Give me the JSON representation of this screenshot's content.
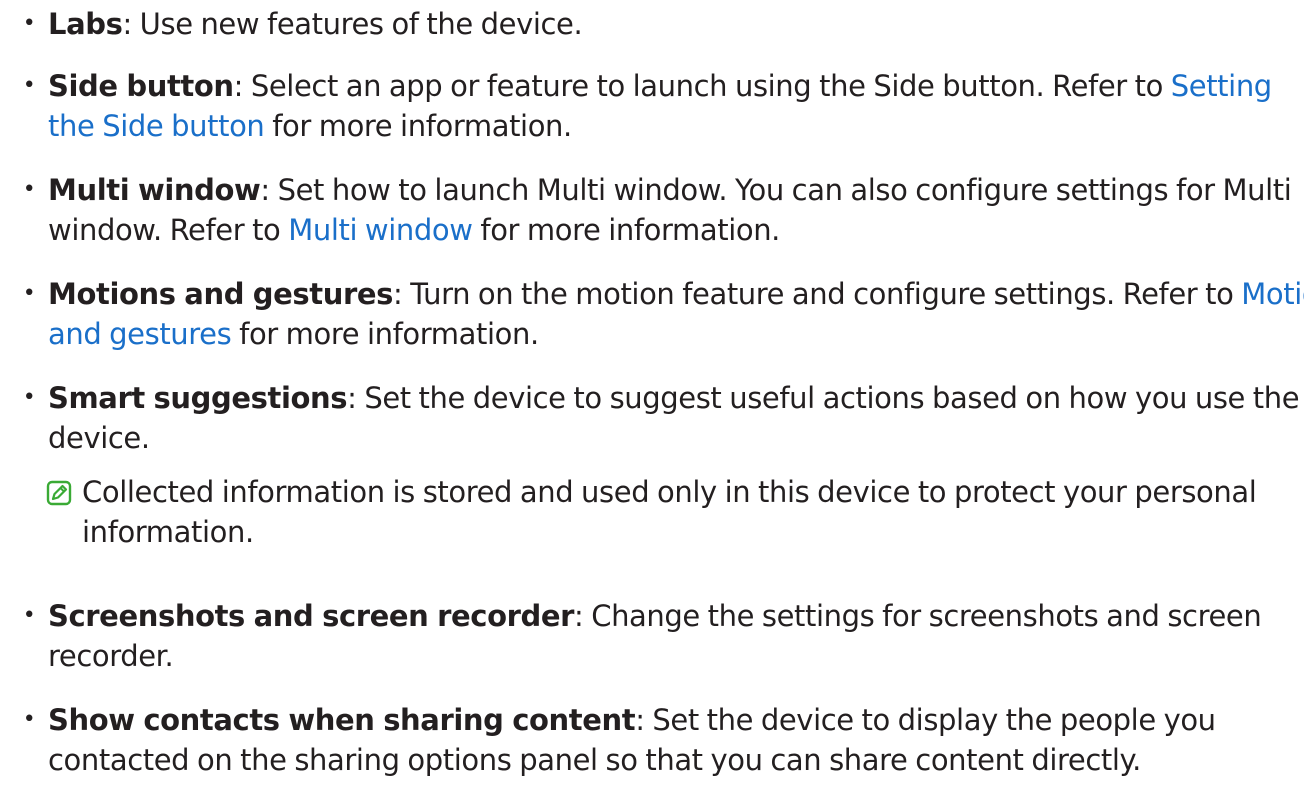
{
  "items": [
    {
      "term": "Labs",
      "before": ": Use new features of the device.",
      "link": "",
      "after": ""
    },
    {
      "term": "Side button",
      "before": ": Select an app or feature to launch using the Side button. Refer to ",
      "link": "Setting the Side button",
      "after": " for more information."
    },
    {
      "term": "Multi window",
      "before": ": Set how to launch Multi window. You can also configure settings for Multi window. Refer to ",
      "link": "Multi window",
      "after": " for more information."
    },
    {
      "term": "Motions and gestures",
      "before": ": Turn on the motion feature and configure settings. Refer to ",
      "link": "Motions and gestures",
      "after": " for more information."
    },
    {
      "term": "Smart suggestions",
      "before": ": Set the device to suggest useful actions based on how you use the device.",
      "link": "",
      "after": ""
    },
    {
      "term": "Screenshots and screen recorder",
      "before": ": Change the settings for screenshots and screen recorder.",
      "link": "",
      "after": ""
    },
    {
      "term": "Show contacts when sharing content",
      "before": ": Set the device to display the people you contacted on the sharing options panel so that you can share content directly.",
      "link": "",
      "after": ""
    }
  ],
  "note": {
    "icon": "note-pencil-icon",
    "text": "Collected information is stored and used only in this device to protect your personal information."
  },
  "colors": {
    "text": "#231f20",
    "link": "#1a6fc9",
    "icon": "#3aaa35"
  }
}
